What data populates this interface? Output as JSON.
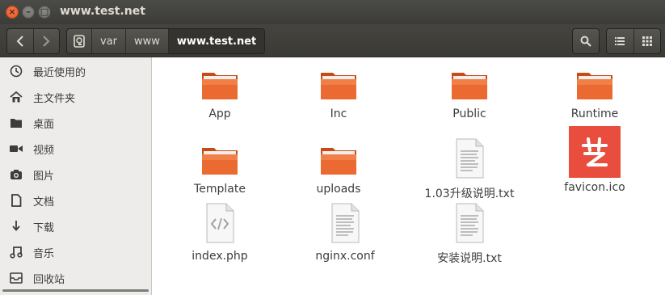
{
  "window": {
    "title": "www.test.net"
  },
  "breadcrumb": [
    "var",
    "www",
    "www.test.net"
  ],
  "sidebar": {
    "items": [
      {
        "label": "最近使用的",
        "icon": "clock-icon"
      },
      {
        "label": "主文件夹",
        "icon": "home-icon"
      },
      {
        "label": "桌面",
        "icon": "desktop-folder-icon"
      },
      {
        "label": "视频",
        "icon": "video-icon"
      },
      {
        "label": "图片",
        "icon": "camera-icon"
      },
      {
        "label": "文档",
        "icon": "document-icon"
      },
      {
        "label": "下载",
        "icon": "download-icon"
      },
      {
        "label": "音乐",
        "icon": "music-icon"
      },
      {
        "label": "回收站",
        "icon": "trash-icon"
      }
    ]
  },
  "files": [
    {
      "name": "App",
      "type": "folder"
    },
    {
      "name": "Inc",
      "type": "folder"
    },
    {
      "name": "Public",
      "type": "folder"
    },
    {
      "name": "Runtime",
      "type": "folder"
    },
    {
      "name": "Template",
      "type": "folder"
    },
    {
      "name": "uploads",
      "type": "folder"
    },
    {
      "name": "1.03升级说明.txt",
      "type": "text"
    },
    {
      "name": "favicon.ico",
      "type": "image"
    },
    {
      "name": "index.php",
      "type": "code"
    },
    {
      "name": "nginx.conf",
      "type": "text"
    },
    {
      "name": "安装说明.txt",
      "type": "text"
    }
  ],
  "colors": {
    "folder": "#e0622a",
    "favicon_bg": "#e84d3d",
    "titlebar": "#3c3b37"
  }
}
